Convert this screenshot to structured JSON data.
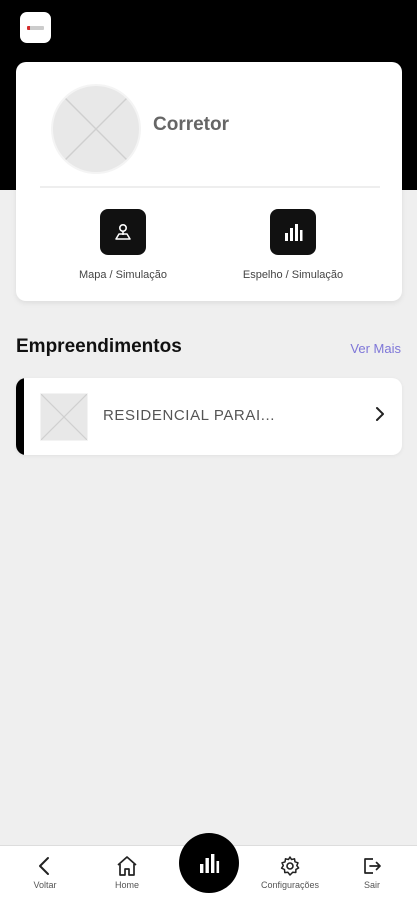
{
  "profile": {
    "name": "Corretor"
  },
  "actions": [
    {
      "label": "Mapa / Simulação",
      "icon": "map-pin-icon"
    },
    {
      "label": "Espelho / Simulação",
      "icon": "bar-chart-icon"
    }
  ],
  "section": {
    "title": "Empreendimentos",
    "see_more": "Ver Mais"
  },
  "projects": [
    {
      "name": "RESIDENCIAL PARAI..."
    }
  ],
  "bottom_nav": {
    "items": [
      {
        "label": "Voltar",
        "icon": "chevron-left-icon"
      },
      {
        "label": "Home",
        "icon": "home-icon"
      },
      {
        "label": "Configurações",
        "icon": "gear-icon"
      },
      {
        "label": "Sair",
        "icon": "logout-icon"
      }
    ],
    "center_icon": "bar-chart-icon"
  },
  "colors": {
    "header_bg": "#000000",
    "page_bg": "#efefef",
    "link": "#7e76d8",
    "accent": "#000000"
  }
}
